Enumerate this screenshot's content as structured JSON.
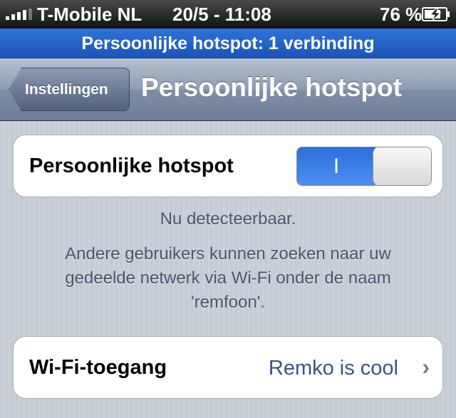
{
  "status_bar": {
    "carrier": "T-Mobile NL",
    "time": "20/5 - 11:08",
    "battery_percent": "76 %",
    "signal_icon": "signal-bars-icon",
    "battery_icon": "battery-charging-icon"
  },
  "banner": {
    "text": "Persoonlijke hotspot: 1 verbinding"
  },
  "navbar": {
    "back_label": "Instellingen",
    "title": "Persoonlijke hotspot"
  },
  "hotspot": {
    "label": "Persoonlijke hotspot",
    "toggle_state_label": "I",
    "enabled": true
  },
  "footer": {
    "status": "Nu detecteerbaar.",
    "info_lines": [
      "Andere gebruikers kunnen zoeken naar uw",
      "gedeelde netwerk via Wi-Fi onder de naam",
      "'remfoon'."
    ]
  },
  "wifi": {
    "label": "Wi-Fi-toegang",
    "value": "Remko is cool",
    "chevron": "›"
  },
  "colors": {
    "background": "#c5ccd4",
    "banner": "#2f73d8",
    "toggle_on": "#2d6fdc",
    "value_text": "#385487"
  }
}
